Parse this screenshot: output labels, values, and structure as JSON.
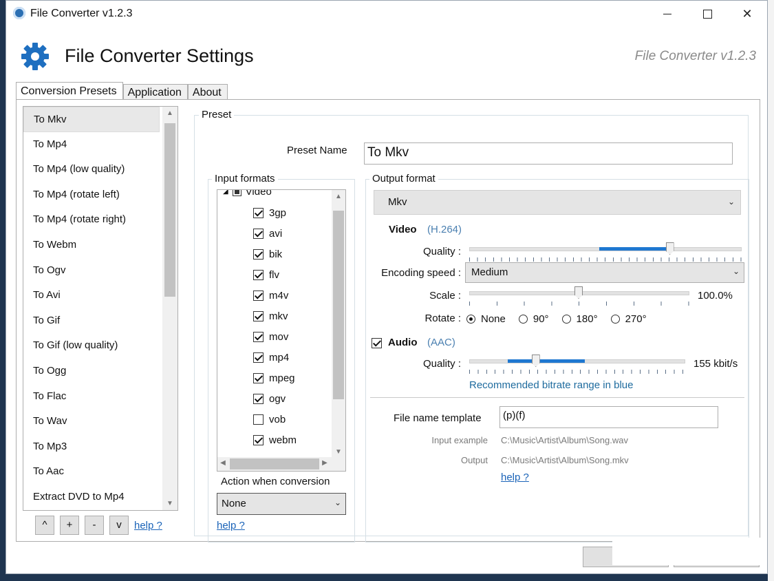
{
  "window": {
    "title": "File Converter v1.2.3",
    "minimize_icon": "minimize-icon",
    "maximize_icon": "maximize-icon",
    "close_icon": "close-icon"
  },
  "header": {
    "title": "File Converter Settings",
    "version": "File Converter v1.2.3",
    "icon": "gear-icon"
  },
  "tabs": [
    {
      "label": "Conversion Presets"
    },
    {
      "label": "Application"
    },
    {
      "label": "About"
    }
  ],
  "presets": {
    "items": [
      {
        "label": "To Mkv"
      },
      {
        "label": "To Mp4"
      },
      {
        "label": "To Mp4 (low quality)"
      },
      {
        "label": "To Mp4 (rotate left)"
      },
      {
        "label": "To Mp4 (rotate right)"
      },
      {
        "label": "To Webm"
      },
      {
        "label": "To Ogv"
      },
      {
        "label": "To Avi"
      },
      {
        "label": "To Gif"
      },
      {
        "label": "To Gif (low quality)"
      },
      {
        "label": "To Ogg"
      },
      {
        "label": "To Flac"
      },
      {
        "label": "To Wav"
      },
      {
        "label": "To Mp3"
      },
      {
        "label": "To Aac"
      },
      {
        "label": "Extract DVD to Mp4"
      }
    ],
    "selected": "To Mkv",
    "buttons": {
      "up": "^",
      "add": "+",
      "remove": "-",
      "down": "v"
    },
    "help": "help ?"
  },
  "preset": {
    "group_label": "Preset",
    "name_label": "Preset Name",
    "name_value": "To Mkv",
    "input_formats": {
      "label": "Input formats",
      "root": "Video",
      "formats": [
        {
          "name": "3gp",
          "checked": true
        },
        {
          "name": "avi",
          "checked": true
        },
        {
          "name": "bik",
          "checked": true
        },
        {
          "name": "flv",
          "checked": true
        },
        {
          "name": "m4v",
          "checked": true
        },
        {
          "name": "mkv",
          "checked": true
        },
        {
          "name": "mov",
          "checked": true
        },
        {
          "name": "mp4",
          "checked": true
        },
        {
          "name": "mpeg",
          "checked": true
        },
        {
          "name": "ogv",
          "checked": true
        },
        {
          "name": "vob",
          "checked": false
        },
        {
          "name": "webm",
          "checked": true
        }
      ],
      "action_label": "Action when conversion",
      "action_value": "None",
      "help": "help ?"
    },
    "output": {
      "label": "Output format",
      "format": "Mkv",
      "video": {
        "title": "Video",
        "codec": "(H.264)",
        "quality_label": "Quality :",
        "quality_level": 0.74,
        "recommended_range": [
          0.48,
          0.75
        ],
        "speed_label": "Encoding speed :",
        "speed_value": "Medium",
        "scale_label": "Scale :",
        "scale_value": "100.0%",
        "scale_level": 0.5,
        "rotate_label": "Rotate :",
        "rotate_options": [
          "None",
          "90°",
          "180°",
          "270°"
        ],
        "rotate_selected": "None"
      },
      "audio": {
        "enabled": true,
        "title": "Audio",
        "codec": "(AAC)",
        "quality_label": "Quality :",
        "quality_value": "155 kbit/s",
        "quality_level": 0.31,
        "recommended_range": [
          0.18,
          0.54
        ],
        "hint": "Recommended bitrate range in blue"
      },
      "filename": {
        "label": "File name template",
        "value": "(p)(f)",
        "input_example_label": "Input example",
        "input_example": "C:\\Music\\Artist\\Album\\Song.wav",
        "output_label": "Output",
        "output_value": "C:\\Music\\Artist\\Album\\Song.mkv",
        "help": "help ?"
      }
    }
  },
  "colors": {
    "accent": "#1f78d1",
    "link": "#1a63b8",
    "codec": "#4a7fb0",
    "background": "#1f3550"
  }
}
